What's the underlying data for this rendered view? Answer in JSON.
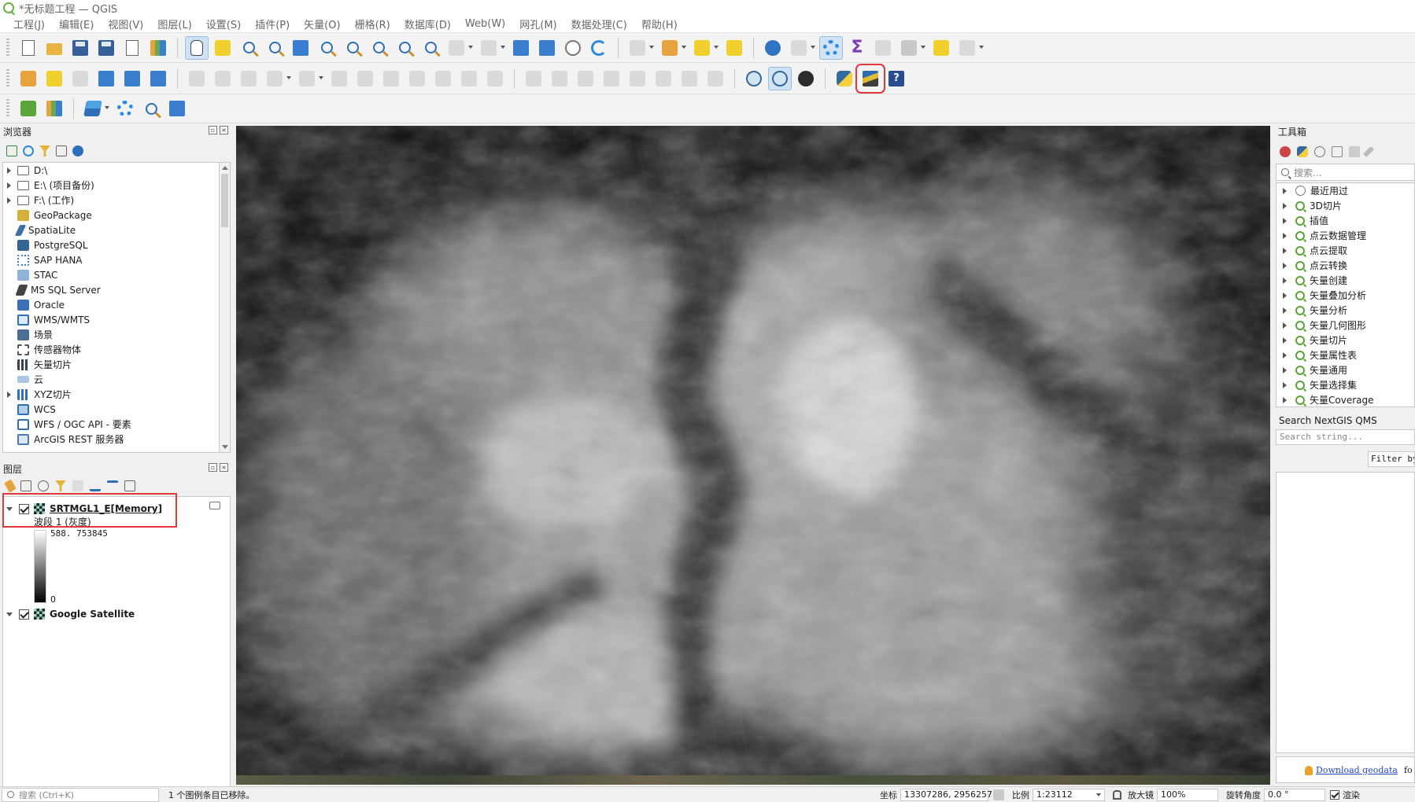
{
  "window": {
    "title": "*无标题工程 — QGIS"
  },
  "menu": [
    "工程(J)",
    "编辑(E)",
    "视图(V)",
    "图层(L)",
    "设置(S)",
    "插件(P)",
    "矢量(O)",
    "栅格(R)",
    "数据库(D)",
    "Web(W)",
    "网孔(M)",
    "数据处理(C)",
    "帮助(H)"
  ],
  "toolbar_icons": {
    "row1": [
      "new-project-icon",
      "open-project-icon",
      "save-project-icon",
      "save-as-icon",
      "layout-icon",
      "style-manager-icon",
      "pan-hand-icon",
      "pan-to-selection-icon",
      "zoom-in-icon",
      "zoom-out-icon",
      "zoom-full-icon",
      "zoom-selection-icon",
      "zoom-layer-icon",
      "zoom-native-icon",
      "zoom-last-icon",
      "zoom-next-icon",
      "new-map-view-icon",
      "new-3d-view-icon",
      "bookmark-icon",
      "show-bookmarks-icon",
      "temporal-icon",
      "refresh-icon",
      "select-icon",
      "deselect-icon",
      "select-value-icon",
      "select-location-icon",
      "identify-icon",
      "attribute-table-icon",
      "processing-toolbox-icon",
      "statistics-icon",
      "field-calc-icon",
      "measure-icon",
      "map-tips-icon",
      "text-annotation-icon"
    ],
    "row2": [
      "data-source-manager-icon",
      "new-geopackage-icon",
      "new-shapefile-icon",
      "new-spatialite-icon",
      "new-temp-layer-icon",
      "new-virtual-layer-icon",
      "digitize-icon",
      "toggle-edit-icon",
      "save-edits-icon",
      "add-feature-icon",
      "vertex-tool-icon",
      "modify-attributes-icon",
      "delete-icon",
      "cut-icon",
      "copy-icon",
      "paste-icon",
      "undo-icon",
      "redo-icon",
      "label-icon",
      "pin-label-icon",
      "show-label-icon",
      "label-tool-icon",
      "highlight-label-icon",
      "move-label-icon",
      "rotate-label-icon",
      "change-label-icon",
      "globe-icon",
      "globe-active-icon",
      "qms-icon",
      "python-console-icon",
      "terrain-plugin-icon",
      "help-icon"
    ],
    "row3": [
      "zoom-plugin-icon",
      "chart-plugin-icon",
      "layers-plugin-icon",
      "settings-gear-icon",
      "search-plugin-icon",
      "fullscreen-icon"
    ]
  },
  "browser": {
    "title": "浏览器",
    "items": [
      {
        "label": "D:\\",
        "icon": "folder-icon",
        "expandable": true
      },
      {
        "label": "E:\\ (项目备份)",
        "icon": "folder-icon",
        "expandable": true
      },
      {
        "label": "F:\\ (工作)",
        "icon": "folder-icon",
        "expandable": true
      },
      {
        "label": "GeoPackage",
        "icon": "geopackage-icon",
        "expandable": false
      },
      {
        "label": "SpatiaLite",
        "icon": "spatialite-icon",
        "expandable": false
      },
      {
        "label": "PostgreSQL",
        "icon": "postgresql-icon",
        "expandable": false
      },
      {
        "label": "SAP HANA",
        "icon": "sap-hana-icon",
        "expandable": false
      },
      {
        "label": "STAC",
        "icon": "stac-icon",
        "expandable": false
      },
      {
        "label": "MS SQL Server",
        "icon": "mssql-icon",
        "expandable": false
      },
      {
        "label": "Oracle",
        "icon": "oracle-icon",
        "expandable": false
      },
      {
        "label": "WMS/WMTS",
        "icon": "wms-icon",
        "expandable": false
      },
      {
        "label": "场景",
        "icon": "scene-icon",
        "expandable": false
      },
      {
        "label": "传感器物体",
        "icon": "sensor-icon",
        "expandable": false
      },
      {
        "label": "矢量切片",
        "icon": "vector-tile-icon",
        "expandable": false
      },
      {
        "label": "云",
        "icon": "cloud-icon",
        "expandable": false
      },
      {
        "label": "XYZ切片",
        "icon": "xyz-tile-icon",
        "expandable": true
      },
      {
        "label": "WCS",
        "icon": "wcs-icon",
        "expandable": false
      },
      {
        "label": "WFS / OGC API - 要素",
        "icon": "wfs-icon",
        "expandable": false
      },
      {
        "label": "ArcGIS REST 服务器",
        "icon": "arcgis-icon",
        "expandable": false
      }
    ]
  },
  "layers": {
    "title": "图层",
    "items": [
      {
        "name": "SRTMGL1_E[Memory]",
        "visible": true,
        "selected": true
      },
      {
        "name": "Google Satellite",
        "visible": true,
        "selected": false
      }
    ],
    "legend": {
      "band": "波段 1 (灰度)",
      "max": "588. 753845",
      "min": "0"
    }
  },
  "toolbox": {
    "title": "工具箱",
    "search_placeholder": "搜索...",
    "items": [
      "最近用过",
      "3D切片",
      "插值",
      "点云数据管理",
      "点云提取",
      "点云转换",
      "矢量创建",
      "矢量叠加分析",
      "矢量分析",
      "矢量几何图形",
      "矢量切片",
      "矢量属性表",
      "矢量通用",
      "矢量选择集",
      "矢量Coverage"
    ]
  },
  "qms": {
    "title": "Search NextGIS QMS",
    "search_placeholder": "Search string...",
    "filter_label": "Filter by extent",
    "download_link": "Download geodata",
    "download_suffix": "fo"
  },
  "status": {
    "search_placeholder": "搜索 (Ctrl+K)",
    "message": "1 个图例条目已移除。",
    "coord_label": "坐标",
    "coord_value": "13307286, 2956257",
    "scale_label": "比例",
    "scale_value": "1:23112",
    "magnifier_label": "放大镜",
    "magnifier_value": "100%",
    "rotation_label": "旋转角度",
    "rotation_value": "0.0 °",
    "render_label": "渲染"
  },
  "colors": {
    "highlight": "#e0383b",
    "qgis_green": "#6bb13f",
    "link": "#2345c8"
  }
}
